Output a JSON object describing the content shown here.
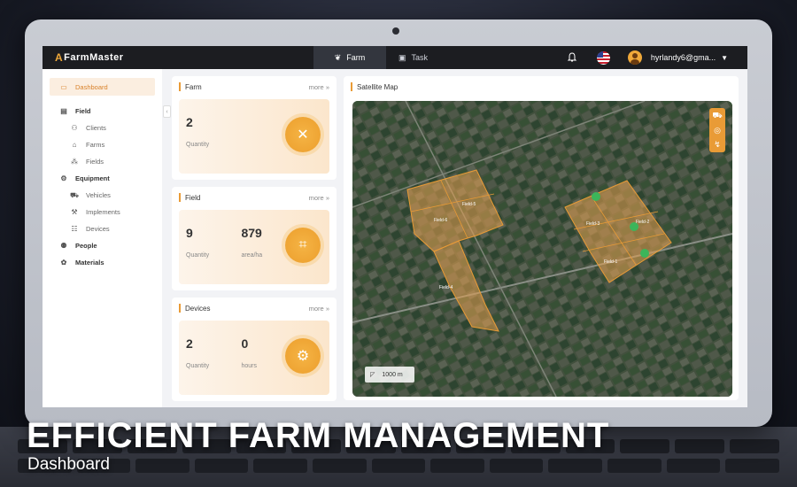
{
  "app": {
    "logo_mark": "A",
    "name": "FarmMaster"
  },
  "topnav": {
    "tabs": [
      {
        "label": "Farm",
        "icon": "farm-icon",
        "active": true
      },
      {
        "label": "Task",
        "icon": "task-icon",
        "active": false
      }
    ],
    "user": "hyrlandy6@gma..."
  },
  "sidebar": {
    "items": [
      {
        "label": "Dashboard",
        "icon": "monitor-icon",
        "kind": "active"
      },
      {
        "label": "Field",
        "icon": "field-icon",
        "kind": "group"
      },
      {
        "label": "Clients",
        "icon": "clients-icon",
        "kind": "sub"
      },
      {
        "label": "Farms",
        "icon": "farms-icon",
        "kind": "sub"
      },
      {
        "label": "Fields",
        "icon": "fields-icon",
        "kind": "sub"
      },
      {
        "label": "Equipment",
        "icon": "equipment-icon",
        "kind": "group"
      },
      {
        "label": "Vehicles",
        "icon": "vehicles-icon",
        "kind": "sub"
      },
      {
        "label": "Implements",
        "icon": "implements-icon",
        "kind": "sub"
      },
      {
        "label": "Devices",
        "icon": "devices-icon",
        "kind": "sub"
      },
      {
        "label": "People",
        "icon": "people-icon",
        "kind": "group"
      },
      {
        "label": "Materials",
        "icon": "materials-icon",
        "kind": "group"
      }
    ]
  },
  "cards": {
    "farm": {
      "title": "Farm",
      "more": "more",
      "stats": [
        {
          "value": "2",
          "label": "Quantity"
        }
      ]
    },
    "field": {
      "title": "Field",
      "more": "more",
      "stats": [
        {
          "value": "9",
          "label": "Quantity"
        },
        {
          "value": "879",
          "label": "area/ha"
        }
      ]
    },
    "devices": {
      "title": "Devices",
      "more": "more",
      "stats": [
        {
          "value": "2",
          "label": "Quantity"
        },
        {
          "value": "0",
          "label": "hours"
        }
      ]
    }
  },
  "map": {
    "title": "Satellite Map",
    "scale": "1000 m",
    "field_labels": [
      "Field-6",
      "Field-5",
      "Field-4",
      "Field-3",
      "Field-2",
      "Field-1"
    ]
  },
  "caption": {
    "title": "EFFICIENT FARM MANAGEMENT",
    "subtitle": "Dashboard"
  },
  "colors": {
    "accent": "#e99b36",
    "nav_bg": "#1c1d21"
  }
}
